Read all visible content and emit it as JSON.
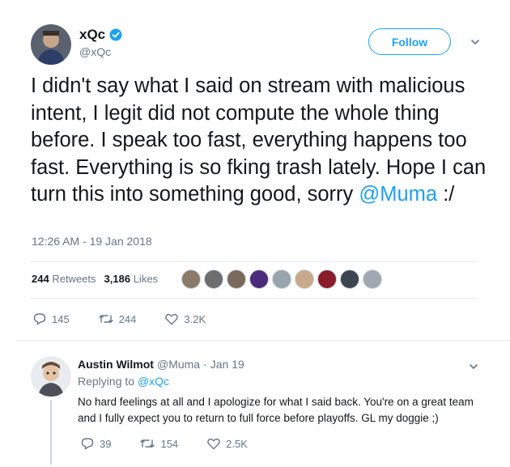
{
  "tweet": {
    "author": {
      "display_name": "xQc",
      "handle": "@xQc",
      "verified": true
    },
    "follow_label": "Follow",
    "text_main": "I didn't say what I said on stream with malicious intent, I legit did not compute the whole thing before. I speak too fast, everything happens too fast. Everything is so fking trash lately. Hope I can turn this into something good, sorry ",
    "text_mention": "@Muma",
    "text_tail": " :/",
    "timestamp": "12:26 AM - 19 Jan 2018",
    "stats": {
      "retweets_count": "244",
      "retweets_label": "Retweets",
      "likes_count": "3,186",
      "likes_label": "Likes"
    },
    "actions": {
      "reply_count": "145",
      "retweet_count": "244",
      "like_count": "3.2K"
    }
  },
  "reply": {
    "author": {
      "display_name": "Austin Wilmot",
      "handle": "@Muma",
      "separator": "·",
      "date": "Jan 19"
    },
    "replying_to_prefix": "Replying to ",
    "replying_to_handle": "@xQc",
    "text": "No hard feelings at all and I apologize for what I said back. You're on a great team and I fully expect you to return to full force before playoffs. GL my doggie ;)",
    "actions": {
      "reply_count": "39",
      "retweet_count": "154",
      "like_count": "2.5K"
    }
  },
  "icons": {
    "verified": "verified-badge-icon",
    "caret": "chevron-down-icon",
    "reply": "reply-icon",
    "retweet": "retweet-icon",
    "like": "heart-icon"
  },
  "colors": {
    "accent": "#1da1f2",
    "muted": "#657786",
    "text": "#14171a",
    "divider": "#e6ecf0"
  }
}
